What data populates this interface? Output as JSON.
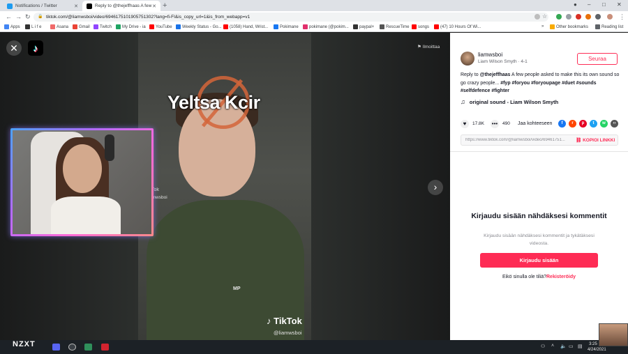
{
  "tabs": [
    {
      "title": "Notifications / Twitter",
      "active": false,
      "icon_color": "#1d9bf0"
    },
    {
      "title": "Reply to @thejeffhaas A few",
      "active": true,
      "icon_color": "#000000"
    }
  ],
  "window_controls": {
    "minimize": "–",
    "maximize": "□",
    "close": "✕"
  },
  "address": {
    "url": "tiktok.com/@liamwsboi/video/6946175101905751302?lang=fi-FI&is_copy_url=1&is_from_webapp=v1"
  },
  "bookmarks": [
    {
      "label": "Apps",
      "color": "#4285f4"
    },
    {
      "label": "L i f e",
      "color": "#333333"
    },
    {
      "label": "Asana",
      "color": "#f06a6a"
    },
    {
      "label": "Gmail",
      "color": "#ea4335"
    },
    {
      "label": "Twitch",
      "color": "#9146ff"
    },
    {
      "label": "My Drive - ia",
      "color": "#1fa463"
    },
    {
      "label": "YouTube",
      "color": "#ff0000"
    },
    {
      "label": "Weekly Status - Go...",
      "color": "#1a73e8"
    },
    {
      "label": "(1058) Hand, Wrist...",
      "color": "#ff0000"
    },
    {
      "label": "Pokimane",
      "color": "#1877f2"
    },
    {
      "label": "pokimane (@pokim...",
      "color": "#e1306c"
    },
    {
      "label": "paypal+",
      "color": "#333333"
    },
    {
      "label": "RescueTime",
      "color": "#555555"
    },
    {
      "label": "songs",
      "color": "#ff0000"
    },
    {
      "label": "(47) 10 Hours Of Wi...",
      "color": "#ff0000"
    }
  ],
  "bookmarks_right": {
    "other": "Other bookmarks",
    "reading": "Reading list"
  },
  "video": {
    "caption": "Yeltsa Kcir",
    "report": "Ilmoittaa",
    "watermark_logo": "TikTok",
    "watermark_user": "@liamwsboi",
    "shirt_logo": "MP",
    "ghost_line1": "Tok",
    "ghost_line2": "amwsboi"
  },
  "author": {
    "username": "liamwsboi",
    "subline": "Liam Wilson Smyth · 4-1",
    "follow": "Seuraa"
  },
  "description": {
    "prefix": "Reply to ",
    "mention": "@thejeffhaas",
    "text": " A few people asked to make this its own sound so go crazy people... ",
    "hashtags": "#fyp #foryou #foryoupage #duet #sounds #selfdefence #fighter"
  },
  "sound": {
    "label": "original sound - Liam Wilson Smyth"
  },
  "stats": {
    "likes": "17.8K",
    "comments": "490",
    "share_label": "Jaa kohteeseen"
  },
  "share_targets": [
    {
      "name": "facebook",
      "glyph": "f",
      "color": "#1877f2"
    },
    {
      "name": "reddit",
      "glyph": "r",
      "color": "#ff4500"
    },
    {
      "name": "pinterest",
      "glyph": "p",
      "color": "#e60023"
    },
    {
      "name": "twitter",
      "glyph": "t",
      "color": "#1da1f2"
    },
    {
      "name": "whatsapp",
      "glyph": "w",
      "color": "#25d366"
    },
    {
      "name": "embed",
      "glyph": "‹›",
      "color": "#555555"
    }
  ],
  "link": {
    "url": "https://www.tiktok.com/@liamwsboi/video/69461751...",
    "copy": "KOPIOI LINKKI"
  },
  "login": {
    "title": "Kirjaudu sisään nähdäksesi kommentit",
    "subtitle": "Kirjaudu sisään nähdäksesi kommentit ja tykätäksesi videosta.",
    "button": "Kirjaudu sisään",
    "signup_prompt": "Eikö sinulla ole tiliä?",
    "signup_link": "Rekisteröidy"
  },
  "taskbar": {
    "brand": "NZXT",
    "time": "3:25 PM",
    "date": "4/24/2021"
  }
}
